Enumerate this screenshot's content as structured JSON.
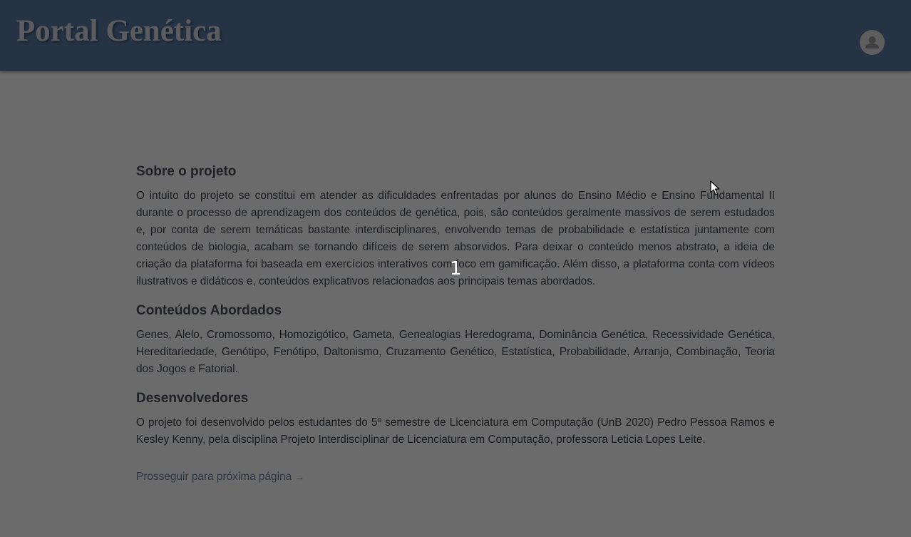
{
  "header": {
    "title": "Portal Genética",
    "avatar_icon": "user-icon",
    "background_color": "#597aa4"
  },
  "sections": [
    {
      "title": "Sobre o projeto",
      "text": "O intuito do projeto se constitui em atender as dificuldades enfrentadas por alunos do Ensino Médio e Ensino Fundamental II durante o processo de aprendizagem dos conteúdos de genética, pois, são conteúdos geralmente massivos de serem estudados e, por conta de serem temáticas bastante interdisciplinares, envolvendo temas de probabilidade e estatística juntamente com conteúdos de biologia, acabam se tornando difíceis de serem absorvidos. Para deixar o conteúdo menos abstrato, a ideia de criação da plataforma foi baseada em exercícios interativos com foco em gamificação. Além disso, a plataforma conta com vídeos ilustrativos e didáticos e, conteúdos explicativos relacionados aos principais temas abordados."
    },
    {
      "title": "Conteúdos Abordados",
      "text": "Genes, Alelo, Cromossomo, Homozigótico, Gameta, Genealogias Heredograma, Dominância Genética, Recessividade Genética, Hereditariedade, Genótipo, Fenótipo, Daltonismo, Cruzamento Genético, Estatística, Probabilidade, Arranjo, Combinação, Teoria dos Jogos e Fatorial."
    },
    {
      "title": "Desenvolvedores",
      "text": "O projeto foi desenvolvido pelos estudantes do 5º semestre de Licenciatura em Computação (UnB 2020) Pedro Pessoa Ramos e Kesley Kenny, pela disciplina Projeto Interdisciplinar de Licenciatura em Computação, professora Leticia Lopes Leite."
    }
  ],
  "next_link": {
    "label": "Prosseguir para próxima página",
    "arrow": "→"
  },
  "overlay": {
    "step_number": "1"
  }
}
